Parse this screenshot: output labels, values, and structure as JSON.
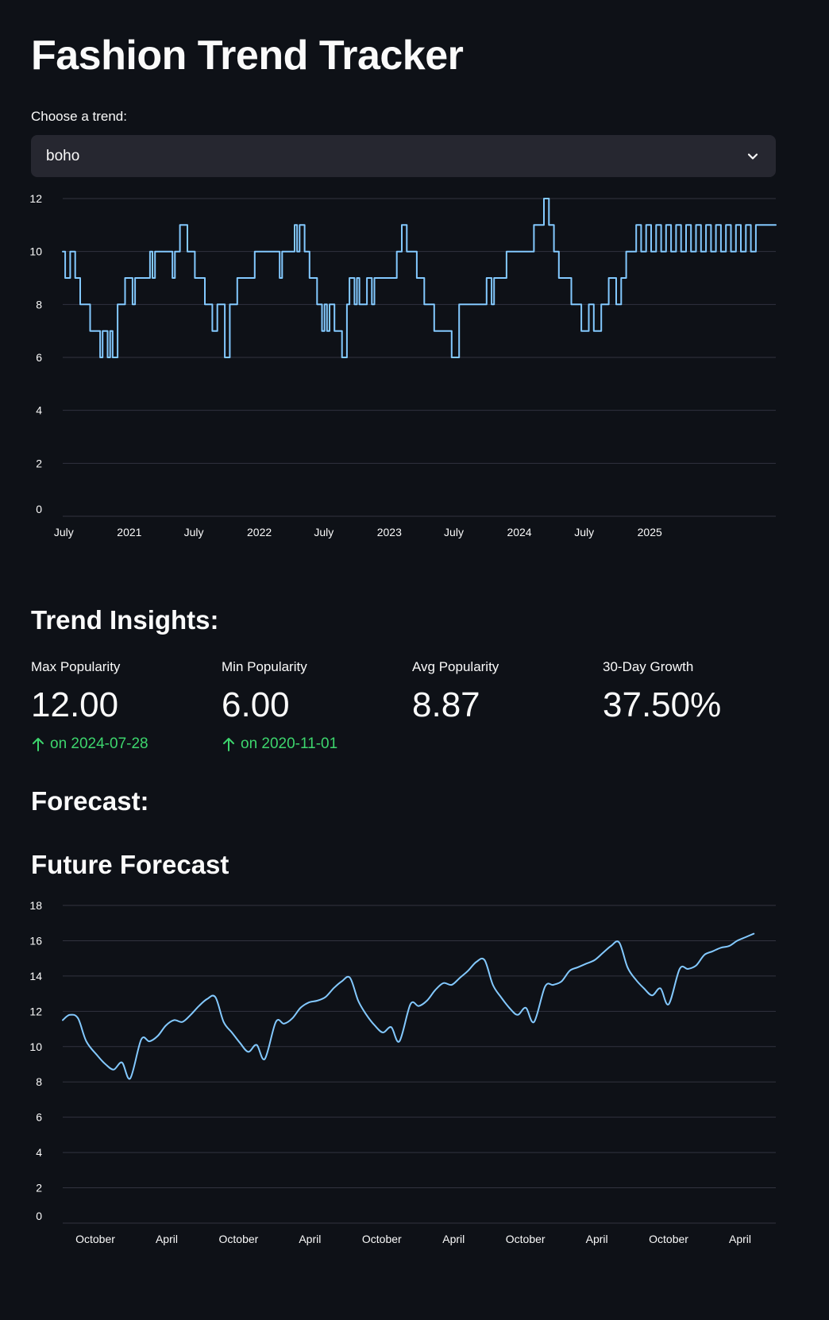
{
  "title": "Fashion Trend Tracker",
  "select": {
    "label": "Choose a trend:",
    "value": "boho",
    "icon": "chevron-down-icon"
  },
  "colors": {
    "background": "#0e1117",
    "line": "#83c9ff",
    "grid": "#31333f",
    "input_bg": "#262730",
    "delta_positive": "#3dd56d"
  },
  "insights": {
    "heading": "Trend Insights:",
    "metrics": [
      {
        "label": "Max Popularity",
        "value": "12.00",
        "delta": "on 2024-07-28",
        "icon": "arrow-up-icon"
      },
      {
        "label": "Min Popularity",
        "value": "6.00",
        "delta": "on 2020-11-01",
        "icon": "arrow-up-icon"
      },
      {
        "label": "Avg Popularity",
        "value": "8.87",
        "delta": ""
      },
      {
        "label": "30-Day Growth",
        "value": "37.50%",
        "delta": ""
      }
    ]
  },
  "forecast": {
    "heading": "Forecast:",
    "subheading": "Future Forecast"
  },
  "chart_data": [
    {
      "type": "line",
      "title": "",
      "xlabel": "",
      "ylabel": "",
      "xlim": [
        "2020-06-28",
        "2025-12-21"
      ],
      "ylim": [
        0,
        12
      ],
      "yticks": [
        0,
        2,
        4,
        6,
        8,
        10,
        12
      ],
      "xticks": [
        {
          "date": "2020-07-01",
          "label": "July"
        },
        {
          "date": "2021-01-01",
          "label": "2021"
        },
        {
          "date": "2021-07-01",
          "label": "July"
        },
        {
          "date": "2022-01-01",
          "label": "2022"
        },
        {
          "date": "2022-07-01",
          "label": "July"
        },
        {
          "date": "2023-01-01",
          "label": "2023"
        },
        {
          "date": "2023-07-01",
          "label": "July"
        },
        {
          "date": "2024-01-01",
          "label": "2024"
        },
        {
          "date": "2024-07-01",
          "label": "July"
        },
        {
          "date": "2025-01-01",
          "label": "2025"
        }
      ],
      "grid": true,
      "step": true,
      "series": [
        {
          "points": [
            [
              "2020-06-28",
              10
            ],
            [
              "2020-07-05",
              9
            ],
            [
              "2020-07-19",
              10
            ],
            [
              "2020-08-02",
              9
            ],
            [
              "2020-08-16",
              8
            ],
            [
              "2020-09-13",
              7
            ],
            [
              "2020-10-11",
              6
            ],
            [
              "2020-10-18",
              7
            ],
            [
              "2020-11-01",
              6
            ],
            [
              "2020-11-08",
              7
            ],
            [
              "2020-11-15",
              6
            ],
            [
              "2020-11-29",
              8
            ],
            [
              "2020-12-20",
              9
            ],
            [
              "2021-01-10",
              8
            ],
            [
              "2021-01-17",
              9
            ],
            [
              "2021-02-21",
              9
            ],
            [
              "2021-02-28",
              10
            ],
            [
              "2021-03-07",
              9
            ],
            [
              "2021-03-14",
              10
            ],
            [
              "2021-05-02",
              9
            ],
            [
              "2021-05-09",
              10
            ],
            [
              "2021-05-23",
              11
            ],
            [
              "2021-06-13",
              10
            ],
            [
              "2021-07-04",
              9
            ],
            [
              "2021-08-01",
              8
            ],
            [
              "2021-08-22",
              7
            ],
            [
              "2021-09-05",
              8
            ],
            [
              "2021-09-26",
              6
            ],
            [
              "2021-10-10",
              8
            ],
            [
              "2021-10-31",
              9
            ],
            [
              "2021-12-19",
              10
            ],
            [
              "2022-01-30",
              10
            ],
            [
              "2022-02-27",
              9
            ],
            [
              "2022-03-06",
              10
            ],
            [
              "2022-03-27",
              10
            ],
            [
              "2022-04-10",
              11
            ],
            [
              "2022-04-17",
              10
            ],
            [
              "2022-04-24",
              11
            ],
            [
              "2022-05-08",
              10
            ],
            [
              "2022-05-22",
              9
            ],
            [
              "2022-06-12",
              8
            ],
            [
              "2022-06-26",
              7
            ],
            [
              "2022-07-03",
              8
            ],
            [
              "2022-07-10",
              7
            ],
            [
              "2022-07-17",
              8
            ],
            [
              "2022-07-31",
              7
            ],
            [
              "2022-08-21",
              6
            ],
            [
              "2022-09-04",
              8
            ],
            [
              "2022-09-11",
              9
            ],
            [
              "2022-09-25",
              8
            ],
            [
              "2022-10-02",
              9
            ],
            [
              "2022-10-09",
              8
            ],
            [
              "2022-10-30",
              9
            ],
            [
              "2022-11-13",
              8
            ],
            [
              "2022-11-20",
              9
            ],
            [
              "2023-01-22",
              10
            ],
            [
              "2023-02-05",
              11
            ],
            [
              "2023-02-19",
              10
            ],
            [
              "2023-03-19",
              9
            ],
            [
              "2023-04-09",
              8
            ],
            [
              "2023-05-07",
              7
            ],
            [
              "2023-05-14",
              7
            ],
            [
              "2023-06-25",
              6
            ],
            [
              "2023-07-16",
              8
            ],
            [
              "2023-09-03",
              8
            ],
            [
              "2023-10-01",
              9
            ],
            [
              "2023-10-15",
              8
            ],
            [
              "2023-10-22",
              9
            ],
            [
              "2023-11-19",
              9
            ],
            [
              "2023-11-26",
              10
            ],
            [
              "2024-01-28",
              10
            ],
            [
              "2024-02-11",
              11
            ],
            [
              "2024-02-25",
              11
            ],
            [
              "2024-03-10",
              12
            ],
            [
              "2024-03-24",
              11
            ],
            [
              "2024-04-07",
              10
            ],
            [
              "2024-04-21",
              9
            ],
            [
              "2024-05-26",
              8
            ],
            [
              "2024-06-23",
              7
            ],
            [
              "2024-07-14",
              8
            ],
            [
              "2024-07-28",
              7
            ],
            [
              "2024-08-18",
              8
            ],
            [
              "2024-09-08",
              9
            ],
            [
              "2024-09-29",
              8
            ],
            [
              "2024-10-13",
              9
            ],
            [
              "2024-10-27",
              10
            ],
            [
              "2024-11-10",
              10
            ],
            [
              "2024-11-24",
              11
            ],
            [
              "2024-12-08",
              10
            ],
            [
              "2024-12-22",
              11
            ],
            [
              "2025-01-05",
              10
            ],
            [
              "2025-01-19",
              11
            ],
            [
              "2025-02-02",
              10
            ],
            [
              "2025-02-16",
              11
            ],
            [
              "2025-03-02",
              10
            ],
            [
              "2025-03-16",
              11
            ],
            [
              "2025-03-30",
              10
            ],
            [
              "2025-04-13",
              11
            ],
            [
              "2025-04-27",
              10
            ],
            [
              "2025-05-11",
              11
            ],
            [
              "2025-05-25",
              10
            ],
            [
              "2025-06-08",
              11
            ],
            [
              "2025-06-22",
              10
            ],
            [
              "2025-07-06",
              11
            ],
            [
              "2025-07-20",
              10
            ],
            [
              "2025-08-03",
              11
            ],
            [
              "2025-08-17",
              10
            ],
            [
              "2025-08-31",
              11
            ],
            [
              "2025-09-14",
              10
            ],
            [
              "2025-09-28",
              11
            ],
            [
              "2025-10-12",
              10
            ],
            [
              "2025-10-26",
              11
            ],
            [
              "2025-11-09",
              11
            ],
            [
              "2025-11-23",
              11
            ],
            [
              "2025-12-07",
              11
            ],
            [
              "2025-12-21",
              11
            ]
          ]
        }
      ]
    },
    {
      "type": "line",
      "title": "Future Forecast",
      "xlabel": "",
      "ylabel": "",
      "xlim": [
        "2025-07-10",
        "2030-07-01"
      ],
      "ylim": [
        0,
        18
      ],
      "yticks": [
        0,
        2,
        4,
        6,
        8,
        10,
        12,
        14,
        16,
        18
      ],
      "xticks": [
        {
          "date": "2025-10-01",
          "label": "October"
        },
        {
          "date": "2026-04-01",
          "label": "April"
        },
        {
          "date": "2026-10-01",
          "label": "October"
        },
        {
          "date": "2027-04-01",
          "label": "April"
        },
        {
          "date": "2027-10-01",
          "label": "October"
        },
        {
          "date": "2028-04-01",
          "label": "April"
        },
        {
          "date": "2028-10-01",
          "label": "October"
        },
        {
          "date": "2029-04-01",
          "label": "April"
        },
        {
          "date": "2029-10-01",
          "label": "October"
        },
        {
          "date": "2030-04-01",
          "label": "April"
        }
      ],
      "grid": true,
      "step": false,
      "series": [
        {
          "points": [
            [
              "2025-07-10",
              11.5
            ],
            [
              "2025-07-28",
              11.8
            ],
            [
              "2025-08-18",
              11.6
            ],
            [
              "2025-09-08",
              10.3
            ],
            [
              "2025-10-06",
              9.5
            ],
            [
              "2025-10-27",
              9.0
            ],
            [
              "2025-11-17",
              8.7
            ],
            [
              "2025-12-08",
              9.1
            ],
            [
              "2025-12-29",
              8.2
            ],
            [
              "2026-01-26",
              10.4
            ],
            [
              "2026-02-16",
              10.3
            ],
            [
              "2026-03-09",
              10.6
            ],
            [
              "2026-03-30",
              11.2
            ],
            [
              "2026-04-20",
              11.5
            ],
            [
              "2026-05-11",
              11.4
            ],
            [
              "2026-06-01",
              11.8
            ],
            [
              "2026-06-22",
              12.3
            ],
            [
              "2026-07-13",
              12.7
            ],
            [
              "2026-08-03",
              12.8
            ],
            [
              "2026-08-24",
              11.4
            ],
            [
              "2026-09-14",
              10.8
            ],
            [
              "2026-10-05",
              10.2
            ],
            [
              "2026-10-26",
              9.7
            ],
            [
              "2026-11-16",
              10.1
            ],
            [
              "2026-12-07",
              9.3
            ],
            [
              "2027-01-04",
              11.4
            ],
            [
              "2027-01-25",
              11.3
            ],
            [
              "2027-02-15",
              11.6
            ],
            [
              "2027-03-08",
              12.2
            ],
            [
              "2027-03-29",
              12.5
            ],
            [
              "2027-04-19",
              12.6
            ],
            [
              "2027-05-10",
              12.8
            ],
            [
              "2027-05-31",
              13.3
            ],
            [
              "2027-06-21",
              13.7
            ],
            [
              "2027-07-12",
              13.9
            ],
            [
              "2027-08-02",
              12.6
            ],
            [
              "2027-08-23",
              11.8
            ],
            [
              "2027-09-13",
              11.2
            ],
            [
              "2027-10-04",
              10.8
            ],
            [
              "2027-10-25",
              11.1
            ],
            [
              "2027-11-15",
              10.3
            ],
            [
              "2027-12-13",
              12.4
            ],
            [
              "2028-01-03",
              12.3
            ],
            [
              "2028-01-24",
              12.6
            ],
            [
              "2028-02-14",
              13.2
            ],
            [
              "2028-03-06",
              13.6
            ],
            [
              "2028-03-27",
              13.5
            ],
            [
              "2028-04-17",
              13.9
            ],
            [
              "2028-05-08",
              14.3
            ],
            [
              "2028-05-29",
              14.8
            ],
            [
              "2028-06-19",
              14.9
            ],
            [
              "2028-07-10",
              13.5
            ],
            [
              "2028-07-31",
              12.8
            ],
            [
              "2028-08-21",
              12.2
            ],
            [
              "2028-09-11",
              11.8
            ],
            [
              "2028-10-02",
              12.2
            ],
            [
              "2028-10-23",
              11.4
            ],
            [
              "2028-11-20",
              13.4
            ],
            [
              "2028-12-11",
              13.5
            ],
            [
              "2029-01-01",
              13.7
            ],
            [
              "2029-01-22",
              14.3
            ],
            [
              "2029-02-12",
              14.5
            ],
            [
              "2029-03-05",
              14.7
            ],
            [
              "2029-03-26",
              14.9
            ],
            [
              "2029-04-16",
              15.3
            ],
            [
              "2029-05-07",
              15.7
            ],
            [
              "2029-05-28",
              15.9
            ],
            [
              "2029-06-18",
              14.5
            ],
            [
              "2029-07-09",
              13.8
            ],
            [
              "2029-07-30",
              13.3
            ],
            [
              "2029-08-20",
              12.9
            ],
            [
              "2029-09-10",
              13.3
            ],
            [
              "2029-10-01",
              12.4
            ],
            [
              "2029-10-29",
              14.4
            ],
            [
              "2029-11-19",
              14.4
            ],
            [
              "2029-12-10",
              14.6
            ],
            [
              "2029-12-31",
              15.2
            ],
            [
              "2030-01-21",
              15.4
            ],
            [
              "2030-02-11",
              15.6
            ],
            [
              "2030-03-04",
              15.7
            ],
            [
              "2030-03-25",
              16.0
            ],
            [
              "2030-04-15",
              16.2
            ],
            [
              "2030-05-06",
              16.4
            ]
          ]
        }
      ]
    }
  ]
}
